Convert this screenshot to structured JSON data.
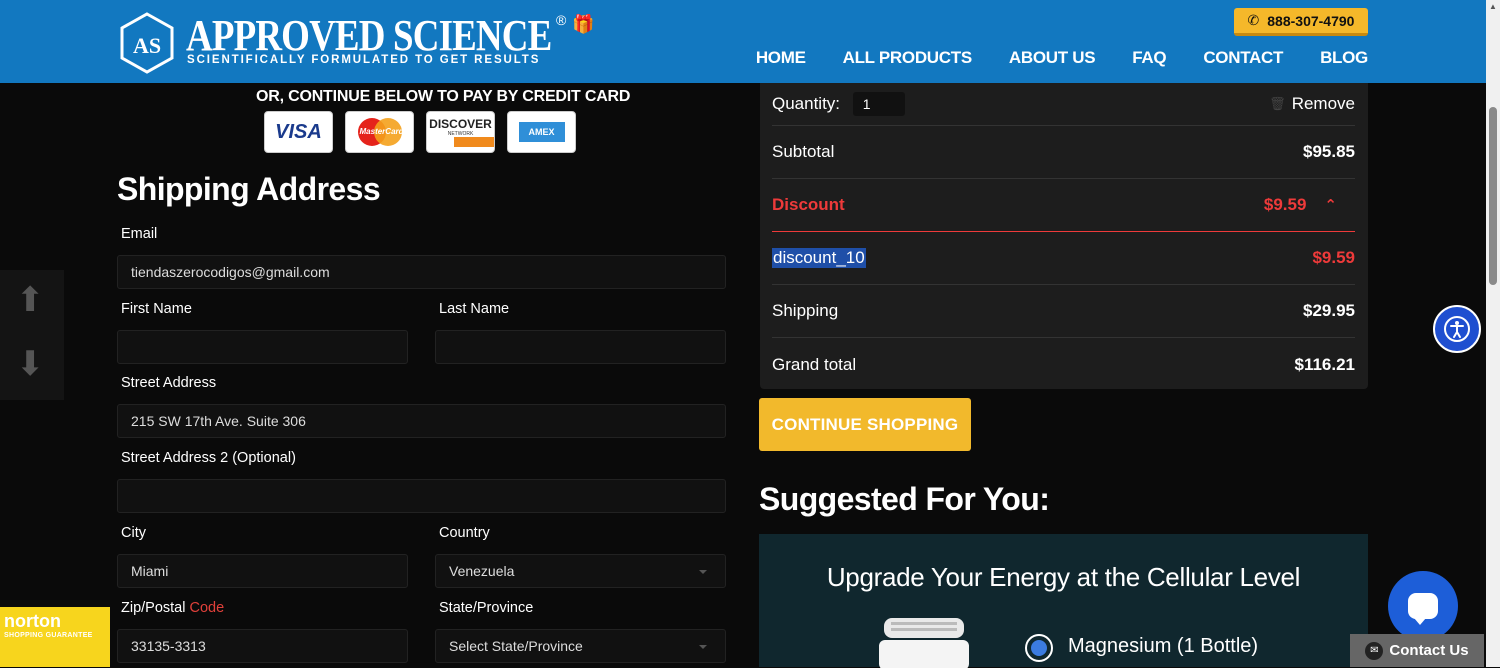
{
  "header": {
    "brand_name": "APPROVED SCIENCE",
    "brand_mark": "AS",
    "reg_mark": "®",
    "tagline": "SCIENTIFICALLY FORMULATED TO GET RESULTS",
    "phone": "888-307-4790",
    "nav": [
      "HOME",
      "ALL PRODUCTS",
      "ABOUT US",
      "FAQ",
      "CONTACT",
      "BLOG"
    ],
    "brand_color": "#1278c0",
    "accent_color": "#f5b82a"
  },
  "payment": {
    "note": "OR, CONTINUE BELOW TO PAY BY CREDIT CARD",
    "cards": {
      "visa": "VISA",
      "mastercard": "MasterCard",
      "discover": "DISCOVER",
      "discover_sub": "NETWORK",
      "amex": "AMEX"
    }
  },
  "shipping": {
    "title": "Shipping Address",
    "email_label": "Email",
    "email_value": "tiendaszerocodigos@gmail.com",
    "first_name_label": "First Name",
    "first_name_value": "",
    "last_name_label": "Last Name",
    "last_name_value": "",
    "street_label": "Street Address",
    "street_value": "215 SW 17th Ave. Suite 306",
    "street2_label": "Street Address 2 (Optional)",
    "street2_value": "",
    "city_label": "City",
    "city_value": "Miami",
    "country_label": "Country",
    "country_value": "Venezuela",
    "zip_label": "Zip/Postal",
    "zip_label_code": "Code",
    "zip_value": "33135-3313",
    "state_label": "State/Province",
    "state_value": "Select State/Province"
  },
  "summary": {
    "quantity_label": "Quantity:",
    "quantity_value": "1",
    "remove_label": "Remove",
    "subtotal_label": "Subtotal",
    "subtotal_value": "$95.85",
    "discount_label": "Discount",
    "discount_value": "$9.59",
    "discount_code": "discount_10",
    "discount_code_value": "$9.59",
    "shipping_label": "Shipping",
    "shipping_value": "$29.95",
    "grand_total_label": "Grand total",
    "grand_total_value": "$116.21",
    "discount_color": "#ee3a3a"
  },
  "continue_button": "CONTINUE SHOPPING",
  "suggested": {
    "title": "Suggested For You:",
    "promo_title": "Upgrade Your Energy at the Cellular Level",
    "option_label": "Magnesium (1 Bottle)"
  },
  "widgets": {
    "norton_name": "norton",
    "norton_sub": "SHOPPING GUARANTEE",
    "contact_tab": "Contact Us"
  }
}
